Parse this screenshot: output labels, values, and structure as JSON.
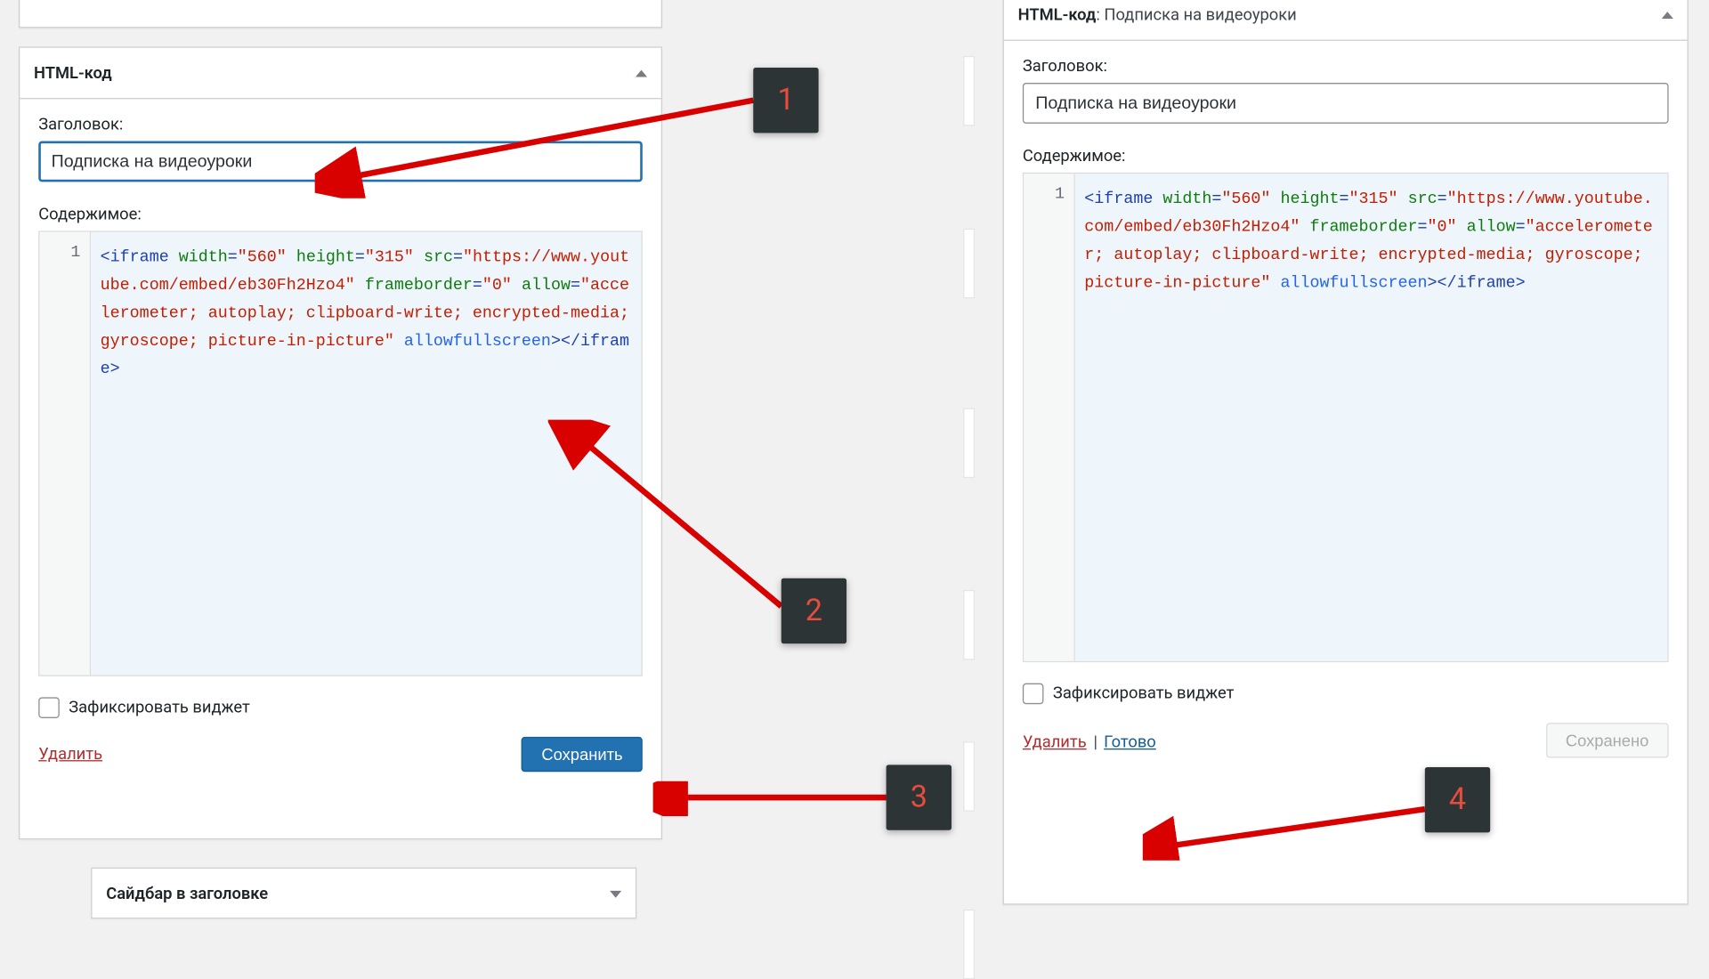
{
  "leftWidget": {
    "title": "HTML-код",
    "field_title_label": "Заголовок:",
    "field_title_value": "Подписка на видеоуроки",
    "field_content_label": "Содержимое:",
    "gutter_line": "1",
    "checkbox_label": "Зафиксировать виджет",
    "delete_label": "Удалить",
    "save_button": "Сохранить"
  },
  "rightWidget": {
    "title_prefix": "HTML-код",
    "title_sub": ": Подписка на видеоуроки",
    "field_title_label": "Заголовок:",
    "field_title_value": "Подписка на видеоуроки",
    "field_content_label": "Содержимое:",
    "gutter_line": "1",
    "checkbox_label": "Зафиксировать виджет",
    "delete_label": "Удалить",
    "done_label": "Готово",
    "saved_button": "Сохранено"
  },
  "bottomBox": {
    "title": "Сайдбар в заголовке"
  },
  "code": {
    "tag_open": "<iframe",
    "attrs": [
      {
        "n": "width",
        "v": "\"560\""
      },
      {
        "n": "height",
        "v": "\"315\""
      },
      {
        "n": "src",
        "v": "\"https://www.youtube.com/embed/eb30Fh2Hzo4\""
      },
      {
        "n": "frameborder",
        "v": "\"0\""
      },
      {
        "n": "allow",
        "v": "\"accelerometer; autoplay; clipboard-write; encrypted-media; gyroscope; picture-in-picture\""
      }
    ],
    "bare_attr": "allowfullscreen",
    "tag_close_open": ">",
    "tag_close": "</iframe>"
  },
  "annotations": {
    "a1": "1",
    "a2": "2",
    "a3": "3",
    "a4": "4"
  }
}
